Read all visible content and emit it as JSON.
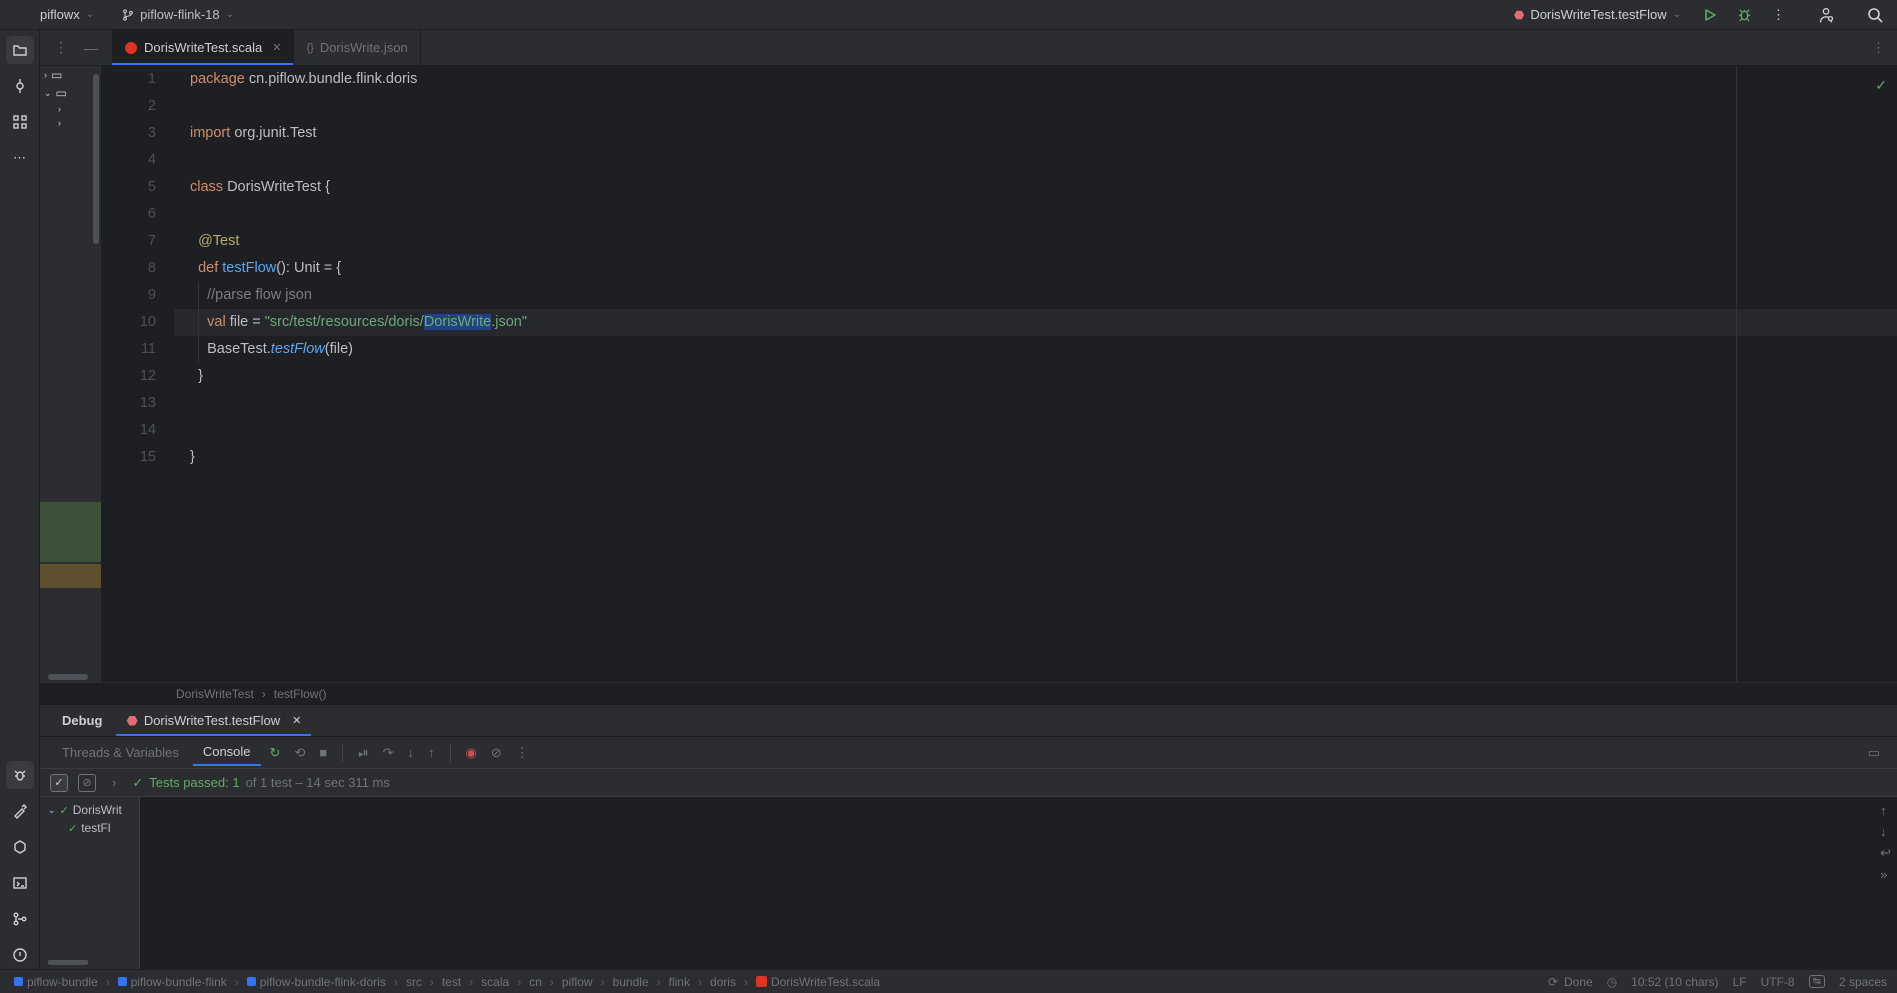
{
  "topbar": {
    "project": "piflowx",
    "branch": "piflow-flink-18",
    "runConfig": "DorisWriteTest.testFlow"
  },
  "tabs": [
    {
      "name": "DorisWriteTest.scala",
      "active": true
    },
    {
      "name": "DorisWrite.json",
      "active": false
    }
  ],
  "code": {
    "l1_pkg": "package",
    "l1_rest": " cn.piflow.bundle.flink.doris",
    "l3_imp": "import",
    "l3_rest": " org.junit.Test",
    "l5_cls": "class",
    "l5_name": " DorisWriteTest ",
    "l5_brace": "{",
    "l7_ann": "@Test",
    "l8_def": "def",
    "l8_fn": "testFlow",
    "l8_sig": "(): Unit = {",
    "l9_cmt": "//parse flow json",
    "l10_val": "val",
    "l10_var": " file = ",
    "l10_str1": "\"src/test/resources/doris/",
    "l10_sel": "DorisWrite",
    "l10_str2": ".json\"",
    "l11_base": "BaseTest.",
    "l11_fn": "testFlow",
    "l11_arg": "(file)",
    "l12_cb": "}",
    "l15_cb": "}"
  },
  "lineNumbers": [
    "1",
    "2",
    "3",
    "4",
    "5",
    "6",
    "7",
    "8",
    "9",
    "10",
    "11",
    "12",
    "13",
    "14",
    "15"
  ],
  "breadcrumbSub": {
    "cls": "DorisWriteTest",
    "fn": "testFlow()"
  },
  "debug": {
    "title": "Debug",
    "configName": "DorisWriteTest.testFlow",
    "threadsTab": "Threads & Variables",
    "consoleTab": "Console",
    "testsPassed": "Tests passed: 1",
    "testsOf": " of 1 test – 14 sec 311 ms",
    "treeRoot": "DorisWrit",
    "treeChild": "testFl"
  },
  "statusbar": {
    "crumbs": [
      "piflow-bundle",
      "piflow-bundle-flink",
      "piflow-bundle-flink-doris",
      "src",
      "test",
      "scala",
      "cn",
      "piflow",
      "bundle",
      "flink",
      "doris",
      "DorisWriteTest.scala"
    ],
    "done": "Done",
    "pos": "10:52 (10 chars)",
    "lf": "LF",
    "enc": "UTF-8",
    "spaces": "2 spaces"
  }
}
